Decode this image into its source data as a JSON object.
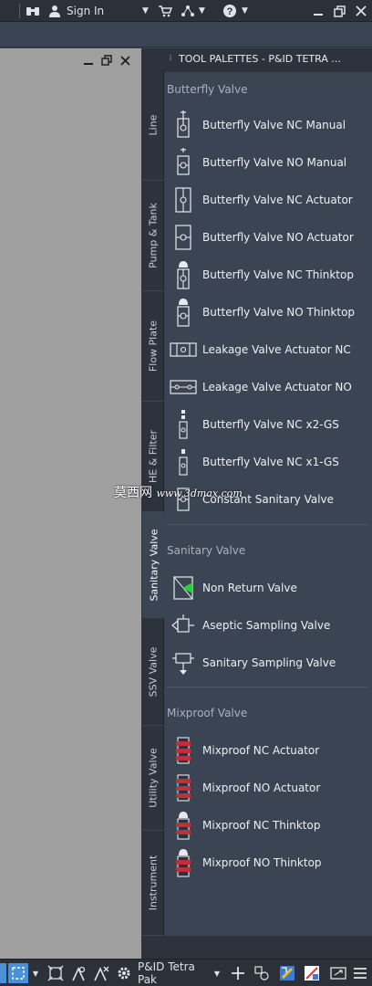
{
  "titlebar": {
    "signin_label": "Sign In",
    "icons": [
      "binoculars-icon",
      "user-icon",
      "dropdown-icon",
      "cart-icon",
      "network-icon",
      "help-icon",
      "minimize-icon",
      "restore-icon",
      "close-icon"
    ]
  },
  "palette": {
    "title": "TOOL PALETTES - P&ID TETRA ...",
    "tabs": [
      {
        "label": "Line"
      },
      {
        "label": "Pump & Tank"
      },
      {
        "label": "Flow Plate"
      },
      {
        "label": "HE & Filter"
      },
      {
        "label": "Sanitary Valve"
      },
      {
        "label": "SSV Valve"
      },
      {
        "label": "Utility Valve"
      },
      {
        "label": "Instrument"
      }
    ],
    "groups": [
      {
        "title": "Butterfly Valve",
        "items": [
          {
            "label": "Butterfly Valve NC Manual",
            "icon": "butterfly-valve-manual-icon"
          },
          {
            "label": "Butterfly Valve NO Manual",
            "icon": "butterfly-valve-manual-icon"
          },
          {
            "label": "Butterfly Valve NC Actuator",
            "icon": "butterfly-valve-actuator-icon"
          },
          {
            "label": "Butterfly Valve NO Actuator",
            "icon": "butterfly-valve-actuator-icon"
          },
          {
            "label": "Butterfly Valve NC Thinktop",
            "icon": "butterfly-valve-thinktop-icon"
          },
          {
            "label": "Butterfly Valve NO Thinktop",
            "icon": "butterfly-valve-thinktop-icon"
          },
          {
            "label": "Leakage Valve Actuator NC",
            "icon": "leakage-valve-icon"
          },
          {
            "label": "Leakage Valve Actuator NO",
            "icon": "leakage-valve-icon"
          },
          {
            "label": "Butterfly Valve NC x2-GS",
            "icon": "butterfly-valve-gs-icon"
          },
          {
            "label": "Butterfly Valve NC x1-GS",
            "icon": "butterfly-valve-gs-icon"
          },
          {
            "label": "Constant Sanitary Valve",
            "icon": "constant-valve-icon"
          }
        ]
      },
      {
        "title": "Sanitary Valve",
        "items": [
          {
            "label": "Non Return Valve",
            "icon": "non-return-valve-icon"
          },
          {
            "label": "Aseptic Sampling Valve",
            "icon": "sampling-valve-icon"
          },
          {
            "label": "Sanitary Sampling Valve",
            "icon": "sampling-valve-icon"
          }
        ]
      },
      {
        "title": "Mixproof Valve",
        "items": [
          {
            "label": "Mixproof NC Actuator",
            "icon": "mixproof-valve-icon"
          },
          {
            "label": "Mixproof NO Actuator",
            "icon": "mixproof-valve-icon"
          },
          {
            "label": "Mixproof NC Thinktop",
            "icon": "mixproof-thinktop-icon"
          },
          {
            "label": "Mixproof NO Thinktop",
            "icon": "mixproof-thinktop-icon"
          }
        ]
      }
    ]
  },
  "statusbar": {
    "workspace_label": "P&ID Tetra Pak"
  },
  "watermark": {
    "cn": "莫西网",
    "url": "www.3dmax.com"
  },
  "colors": {
    "titlebar": "#2b3039",
    "palette_bg": "#3b4453",
    "drawing_bg": "#a0a0a0",
    "accent_green": "#2ecc40",
    "mixproof_red": "#c0303a"
  }
}
